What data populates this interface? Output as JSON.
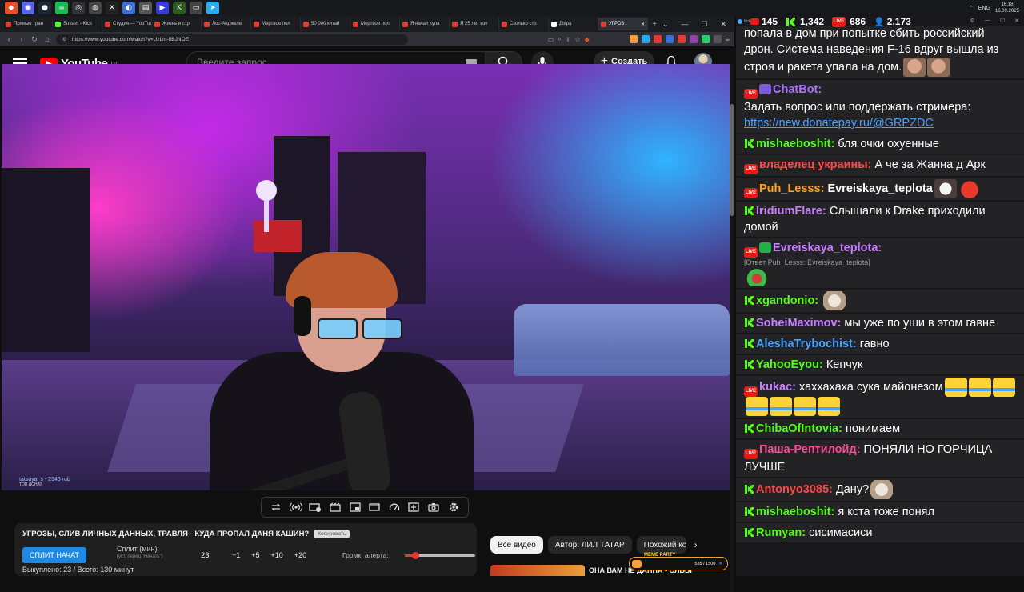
{
  "taskbar": {
    "icons": [
      {
        "name": "brave-icon",
        "color": "#e5502a",
        "glyph": "◆"
      },
      {
        "name": "discord-icon",
        "color": "#5865f2",
        "glyph": "◉"
      },
      {
        "name": "steam-icon",
        "color": "#1b2838",
        "glyph": "●"
      },
      {
        "name": "spotify-icon",
        "color": "#1db954",
        "glyph": "≡"
      },
      {
        "name": "obs-icon",
        "color": "#333333",
        "glyph": "◎"
      },
      {
        "name": "chrome-icon",
        "color": "#444444",
        "glyph": "◍"
      },
      {
        "name": "capcut-icon",
        "color": "#222222",
        "glyph": "✕"
      },
      {
        "name": "davinci-icon",
        "color": "#3a6fd8",
        "glyph": "◐"
      },
      {
        "name": "explorer-icon",
        "color": "#555555",
        "glyph": "▤"
      },
      {
        "name": "media-icon",
        "color": "#3a3ad8",
        "glyph": "▶"
      },
      {
        "name": "kick-app-icon",
        "color": "#2d5a1e",
        "glyph": "K"
      },
      {
        "name": "folder-icon",
        "color": "#444444",
        "glyph": "▭"
      },
      {
        "name": "telegram-icon",
        "color": "#2aabee",
        "glyph": "➤"
      }
    ],
    "lang": "ENG",
    "time": "16:18",
    "date": "16.09.2025"
  },
  "browser": {
    "tabs": [
      {
        "label": "Прямые тран",
        "color": "#e53935"
      },
      {
        "label": "Stream - Kick",
        "color": "#53fc18"
      },
      {
        "label": "Студия — YouTube",
        "color": "#e53935"
      },
      {
        "label": "Жизнь и стр",
        "color": "#e53935"
      },
      {
        "label": "Лос-Анджеле",
        "color": "#e53935"
      },
      {
        "label": "Мертвое пол",
        "color": "#e53935"
      },
      {
        "label": "50 000 китай",
        "color": "#e53935"
      },
      {
        "label": "Мертвое пол",
        "color": "#e53935"
      },
      {
        "label": "Я начал купа",
        "color": "#e53935"
      },
      {
        "label": "Я 25 лет изу",
        "color": "#e53935"
      },
      {
        "label": "Сколько сто",
        "color": "#e53935"
      },
      {
        "label": "Дbiра",
        "color": "#ffffff"
      },
      {
        "label": "УГРОЗ",
        "color": "#e53935",
        "active": true
      }
    ],
    "url": "https://www.youtube.com/watch?v=UzLm-8BJNOE"
  },
  "youtube": {
    "logo_text": "YouTube",
    "region": "LV",
    "search_placeholder": "Введите запрос",
    "create_label": "Создать"
  },
  "video": {
    "donation_text": "tatsuya_s - 2346 rub",
    "donation_sub": "ТОП ДОНАТ"
  },
  "plugin": {
    "title": "УГРОЗЫ, СЛИВ ЛИЧНЫХ ДАННЫХ, ТРАВЛЯ - КУДА ПРОПАЛ ДАНЯ КАШИН?",
    "copy_label": "Копировать",
    "split_button": "СПЛИТ НАЧАТ",
    "split_label": "Сплит (мин):",
    "split_hint": "(уст. перед \"Начать\")",
    "split_value": "23",
    "increments": [
      "+1",
      "+5",
      "+10",
      "+20"
    ],
    "alert_label": "Громк. алерта:",
    "alert_volume": 0.15,
    "footer": "Выкуплено: 23 / Всего: 130 минут"
  },
  "chips": {
    "items": [
      "Все видео",
      "Автор: ЛИЛ ТАТАР",
      "Похожий ко"
    ],
    "sidebar_title": "ОНА ВАМ НЕ ДАННА - ОЛЬЫ",
    "meme_title": "MEME PARTY",
    "meme_progress": "535 / 1500",
    "meme_value": 535,
    "meme_max": 1500
  },
  "chat": {
    "app_label": "kickChat",
    "stats": {
      "youtube": "145",
      "kick": "1,342",
      "live": "686",
      "viewers": "2,173"
    },
    "colors": {
      "kick": "#53fc18",
      "live": "#e91916",
      "viewers": "#4aa3ff"
    },
    "messages": [
      {
        "first_text": "попала в дом при попытке сбить российский дрон. Система наведения F-16 вдруг вышла из строя и ракета упала на дом.",
        "emotes": [
          "face",
          "face"
        ]
      },
      {
        "user": "ChatBot:",
        "color": "#a970ff",
        "badges": [
          "live",
          "bot"
        ],
        "text": "Задать вопрос или поддержать стримера:",
        "link": "https://new.donatepay.ru/@GRPZDC",
        "break": true
      },
      {
        "user": "mishaeboshit:",
        "color": "#53fc18",
        "badges": [
          "kick"
        ],
        "text": "бля очки охуенные"
      },
      {
        "user": "владелец украины:",
        "color": "#ff4a4a",
        "badges": [
          "live"
        ],
        "text": "А че за Жанна д Арк"
      },
      {
        "user": "Puh_Lesss:",
        "color": "#ff9f1a",
        "badges": [
          "live"
        ],
        "bold_text": "Evreiskaya_teplota",
        "emotes": [
          "rat",
          "heart"
        ]
      },
      {
        "user": "IridiumFlare:",
        "color": "#c77dff",
        "badges": [
          "kick"
        ],
        "text": "Слышали к Drake приходили домой"
      },
      {
        "user": "Evreiskaya_teplota:",
        "color": "#c77dff",
        "badges": [
          "live",
          "pen"
        ],
        "reply": "[Ответ Puh_Lesss: Evreiskaya_teplota]",
        "emotes": [
          "frog"
        ],
        "break": true
      },
      {
        "user": "xgandonio:",
        "color": "#53fc18",
        "badges": [
          "kick"
        ],
        "emotes": [
          "cat"
        ]
      },
      {
        "user": "SoheiMaximov:",
        "color": "#c77dff",
        "badges": [
          "kick"
        ],
        "text": "мы уже по уши в этом гавне"
      },
      {
        "user": "AleshaTrybochist:",
        "color": "#4aa3ff",
        "badges": [
          "kick"
        ],
        "text": "гавно"
      },
      {
        "user": "YahooEyou:",
        "color": "#53fc18",
        "badges": [
          "kick"
        ],
        "text": "Кепчук"
      },
      {
        "user": "kukac:",
        "color": "#c77dff",
        "badges": [
          "live"
        ],
        "text": "хаххахаха сука майонезом",
        "emotes": [
          "laugh",
          "laugh",
          "laugh",
          "laugh",
          "laugh",
          "laugh",
          "laugh"
        ]
      },
      {
        "user": "ChibaOfIntovia:",
        "color": "#53fc18",
        "badges": [
          "kick"
        ],
        "text": "понимаем"
      },
      {
        "user": "Паша-Рептилойд:",
        "color": "#ff4a9a",
        "badges": [
          "live"
        ],
        "text": "ПОНЯЛИ НО ГОРЧИЦА ЛУЧШЕ"
      },
      {
        "user": "Antonyo3085:",
        "color": "#ff4a4a",
        "badges": [
          "kick"
        ],
        "text": "Дану?",
        "emotes": [
          "cat"
        ]
      },
      {
        "user": "mishaeboshit:",
        "color": "#53fc18",
        "badges": [
          "kick"
        ],
        "text": "я кста тоже понял"
      },
      {
        "user": "Rumyan:",
        "color": "#53fc18",
        "badges": [
          "kick"
        ],
        "text": "сисимасиси"
      }
    ]
  }
}
